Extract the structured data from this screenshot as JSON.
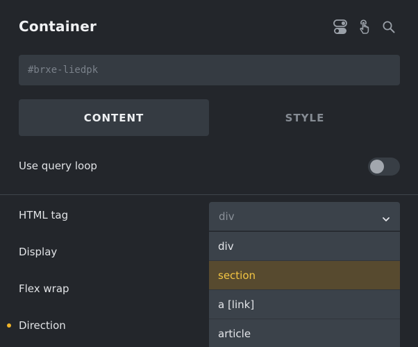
{
  "header": {
    "title": "Container"
  },
  "id_field": {
    "placeholder": "#brxe-liedpk"
  },
  "tabs": [
    {
      "label": "CONTENT",
      "active": true
    },
    {
      "label": "STYLE",
      "active": false
    }
  ],
  "controls": {
    "query_loop": {
      "label": "Use query loop",
      "enabled": false
    },
    "html_tag": {
      "label": "HTML tag",
      "value": "div"
    },
    "display": {
      "label": "Display"
    },
    "flex_wrap": {
      "label": "Flex wrap"
    },
    "direction": {
      "label": "Direction"
    }
  },
  "dropdown": {
    "options": [
      {
        "label": "div"
      },
      {
        "label": "section",
        "highlighted": true
      },
      {
        "label": "a [link]"
      },
      {
        "label": "article"
      }
    ]
  },
  "colors": {
    "background": "#23262b",
    "field": "#353b42",
    "dropdown": "#3b424a",
    "highlight_bg": "#574a2f",
    "highlight_text": "#f3c543",
    "indicator_dot": "#f0b429"
  },
  "icons": [
    "toggle-settings-icon",
    "hand-pointer-icon",
    "search-icon",
    "chevron-down-icon"
  ]
}
